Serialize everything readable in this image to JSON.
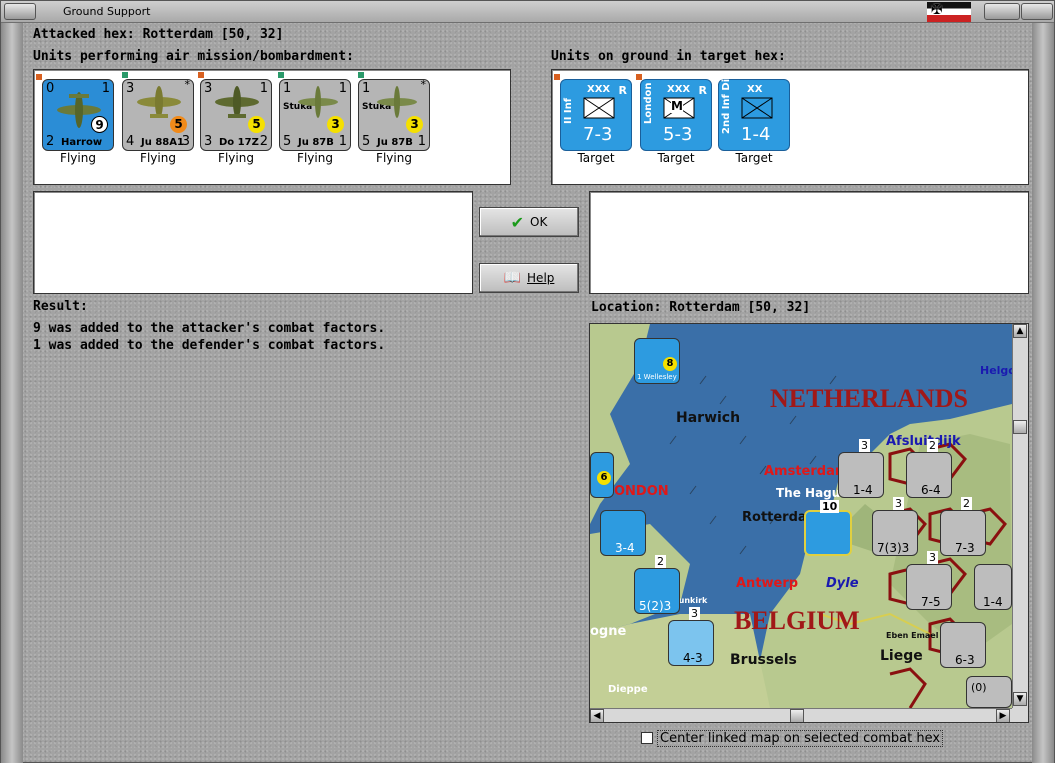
{
  "window": {
    "title": "Ground Support"
  },
  "header": {
    "attacked_hex": "Attacked hex: Rotterdam  [50, 32]"
  },
  "air": {
    "label": "Units performing air mission/bombardment:",
    "units": [
      {
        "tl": "0",
        "tr": "1",
        "bl": "2",
        "br": "",
        "name": "Harrow",
        "badge": "9",
        "caption": "Flying"
      },
      {
        "tl": "3",
        "tr": "",
        "bl": "4",
        "br": "3",
        "name": "Ju 88A1",
        "badge": "5",
        "caption": "Flying",
        "star": "*"
      },
      {
        "tl": "3",
        "tr": "1",
        "bl": "3",
        "br": "2",
        "name": "Do 17Z",
        "badge": "5",
        "caption": "Flying"
      },
      {
        "tl": "1",
        "tr": "1",
        "bl": "5",
        "br": "1",
        "name": "Ju 87B",
        "sub": "Stuka",
        "badge": "3",
        "caption": "Flying"
      },
      {
        "tl": "1",
        "tr": "",
        "bl": "5",
        "br": "1",
        "name": "Ju 87B",
        "sub": "Stuka",
        "badge": "3",
        "caption": "Flying",
        "star": "*"
      }
    ]
  },
  "ground": {
    "label": "Units on ground in target hex:",
    "units": [
      {
        "side": "II Inf",
        "size": "XXX",
        "r": "R",
        "value": "7-3",
        "caption": "Target"
      },
      {
        "side": "London",
        "size": "XXX",
        "r": "R",
        "value": "5-3",
        "caption": "Target",
        "m": "M"
      },
      {
        "side": "2nd Inf Div",
        "size": "XX",
        "r": "",
        "value": "1-4",
        "caption": "Target"
      }
    ]
  },
  "buttons": {
    "ok": "OK",
    "help": "Help"
  },
  "result": {
    "label": "Result:",
    "lines": [
      "9 was added to the attacker's combat factors.",
      "1 was added to the defender's combat factors."
    ]
  },
  "location": {
    "label": "Location:  Rotterdam  [50, 32]"
  },
  "map": {
    "countries": [
      "NETHERLANDS",
      "BELGIUM"
    ],
    "cities": [
      "Harwich",
      "Amsterdam",
      "The Hague",
      "Rotterdam",
      "Antwerp",
      "Brussels",
      "Liege",
      "Dieppe",
      "ONDON",
      "ogne",
      "Dyle",
      "Afsluitdijk",
      "Helgo",
      "Dunkirk",
      "Eben Emael"
    ],
    "counters": [
      {
        "value": "1-4",
        "top": "3"
      },
      {
        "value": "6-4",
        "top": "2"
      },
      {
        "value": "7(3)3",
        "top": "3"
      },
      {
        "value": "7-3",
        "top": "2"
      },
      {
        "value": "3-4"
      },
      {
        "value": "5(2)3",
        "top": "2"
      },
      {
        "value": "7-5",
        "top": "3"
      },
      {
        "value": "1-4"
      },
      {
        "value": "4-3",
        "top": "3"
      },
      {
        "value": "6-3"
      },
      {
        "value": "8",
        "label": "1 Wellesley"
      },
      {
        "value": "6"
      },
      {
        "value": "10"
      },
      {
        "value": "(0)"
      }
    ]
  },
  "checkbox": {
    "label": "Center linked map on selected combat hex",
    "checked": false
  },
  "colors": {
    "ground_unit": "#2d9be0",
    "selected_air": "#2b8dd6",
    "country_text": "#a11818",
    "city_red": "#e01818",
    "sea": "#3a6fa8",
    "land": "#b8c98f"
  }
}
